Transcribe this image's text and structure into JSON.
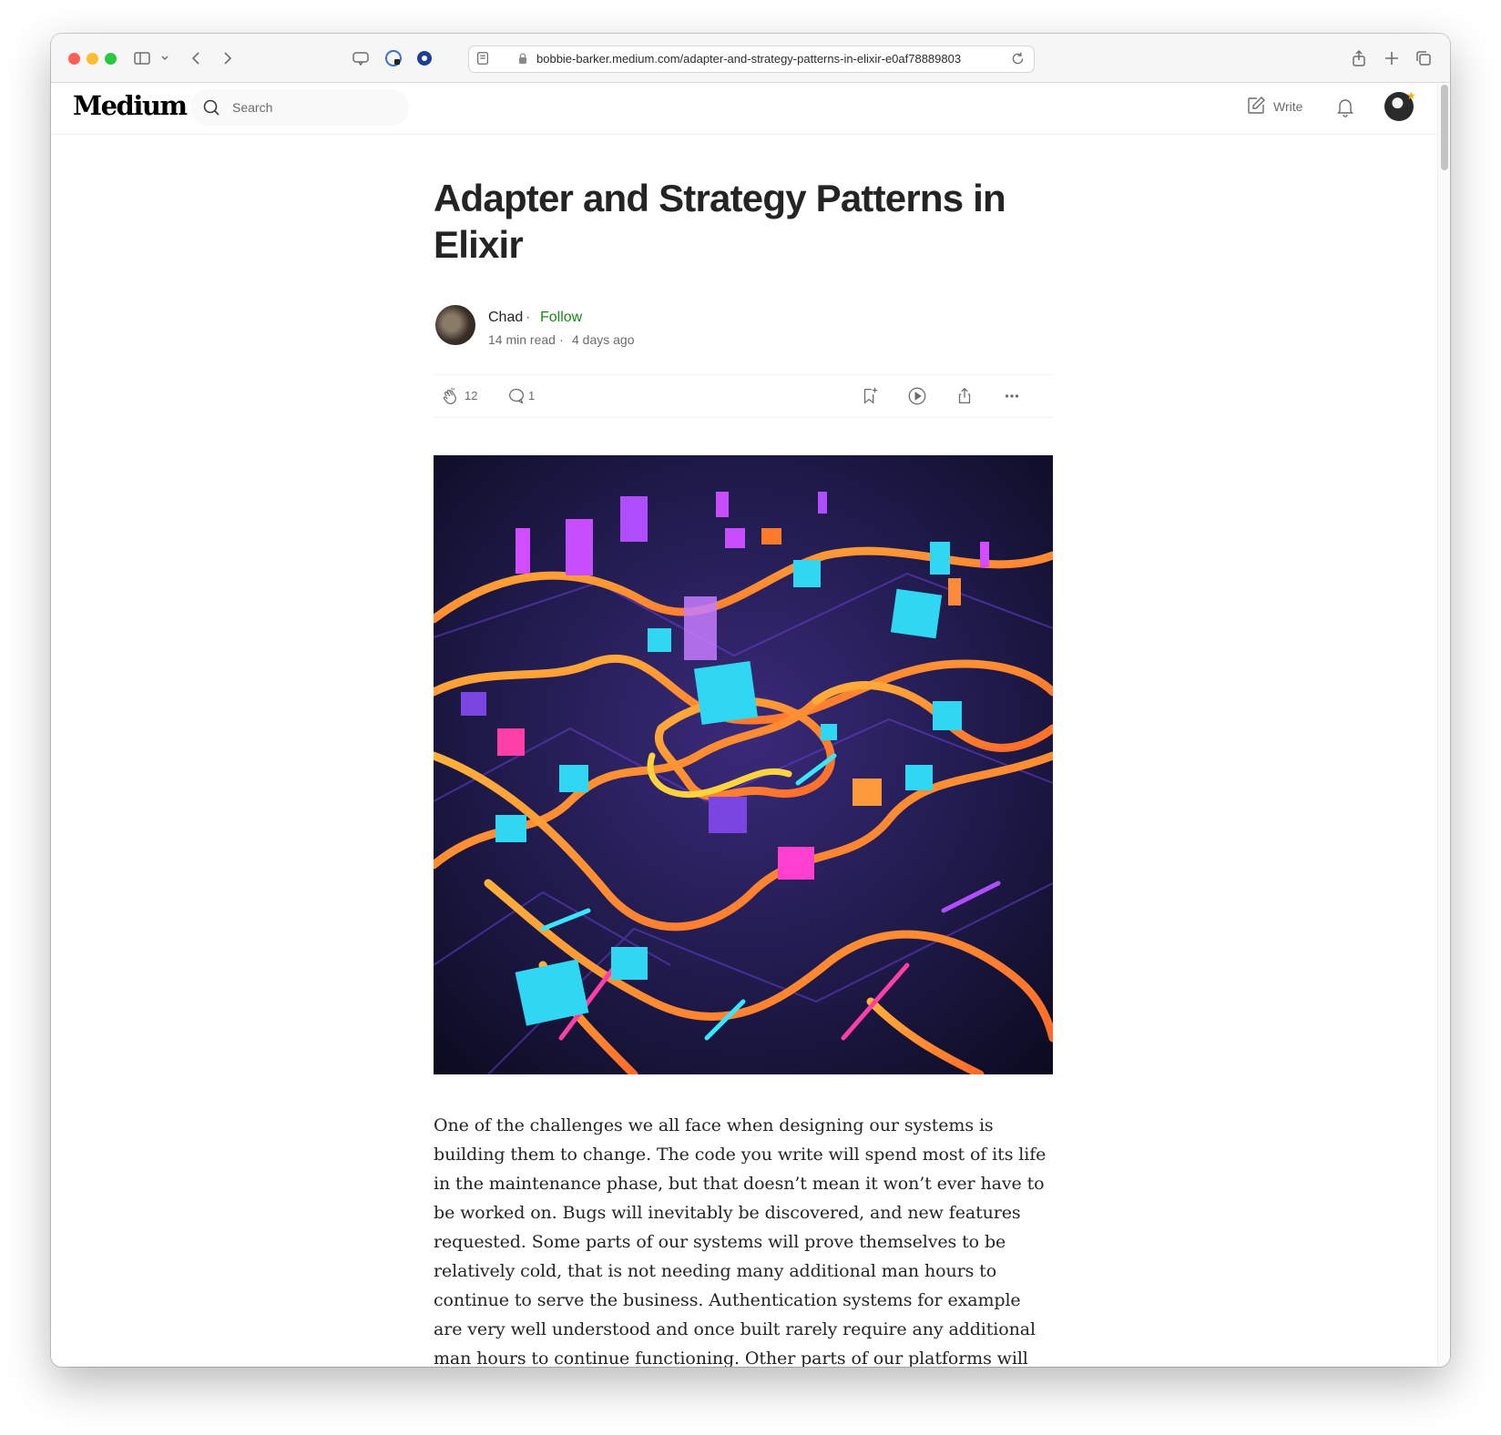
{
  "browser": {
    "url": "bobbie-barker.medium.com/adapter-and-strategy-patterns-in-elixir-e0af78889803"
  },
  "nav": {
    "logo": "Medium",
    "search_placeholder": "Search",
    "write_label": "Write"
  },
  "article": {
    "title": "Adapter and Strategy Patterns in Elixir",
    "author": "Chad",
    "separator": "·",
    "follow_label": "Follow",
    "read_time": "14 min read",
    "published": "4 days ago",
    "claps": "12",
    "comments": "1",
    "body": "One of the challenges we all face when designing our systems is building them to change. The code you write will spend most of its life in the maintenance phase, but that doesn’t mean it won’t ever have to be worked on. Bugs will inevitably be discovered, and new features requested. Some parts of our systems will prove themselves to be relatively cold, that is not needing many additional man hours to continue to serve the business. Authentication systems for example are very well understood and once built rarely require any additional man hours to continue functioning. Other parts of our platforms will be hot, that is requiring many additional man hours to"
  },
  "colors": {
    "accent_green": "#1a8917",
    "text_primary": "#242424",
    "text_secondary": "#6b6b6b",
    "traffic_red": "#ff5f57",
    "traffic_yellow": "#febc2e",
    "traffic_green": "#28c840"
  },
  "icons": [
    "sidebar-icon",
    "chevron-left-icon",
    "chevron-right-icon",
    "reader-icon",
    "lock-icon",
    "reload-icon",
    "share-icon",
    "plus-icon",
    "tabs-icon",
    "search-icon",
    "write-icon",
    "bell-icon",
    "clap-icon",
    "comment-icon",
    "bookmark-icon",
    "play-icon",
    "more-icon"
  ]
}
